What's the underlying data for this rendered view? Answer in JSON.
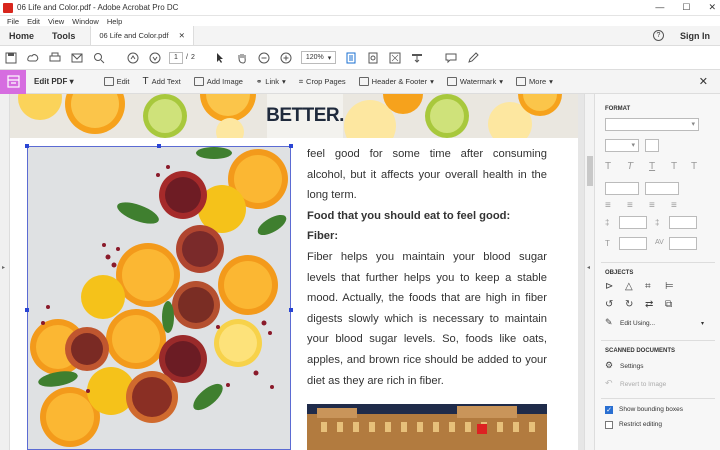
{
  "window": {
    "title": "06 Life and Color.pdf - Adobe Acrobat Pro DC",
    "controls": [
      "—",
      "☐",
      "✕"
    ]
  },
  "menu": [
    "File",
    "Edit",
    "View",
    "Window",
    "Help"
  ],
  "tabs": {
    "home": "Home",
    "tools": "Tools",
    "document": "06 Life and Color.pdf",
    "close": "✕",
    "help": "?",
    "signin": "Sign In"
  },
  "toolbar": {
    "page_current": "1",
    "page_sep": "/",
    "page_total": "2",
    "zoom": "120%"
  },
  "editbar": {
    "title": "Edit PDF",
    "items": [
      "Edit",
      "Add Text",
      "Add Image",
      "Link",
      "Crop Pages",
      "Header & Footer",
      "Watermark",
      "More"
    ],
    "close": "✕"
  },
  "document": {
    "logo": "BETTER.",
    "paragraphs": [
      {
        "style": "normal",
        "text": "feel good for some time after consuming alcohol, but it affects your overall health in the long term."
      },
      {
        "style": "bold",
        "text": "Food that you should eat to feel good:"
      },
      {
        "style": "bold",
        "text": "Fiber:"
      },
      {
        "style": "normal",
        "text": "Fiber helps you maintain your blood sugar levels that further helps you to keep a stable mood. Actually, the foods that are high in fiber digests slowly which is necessary to maintain your blood sugar levels. So, foods like oats, apples, and brown rice should be added to your diet as they are rich in fiber."
      }
    ]
  },
  "rightpanel": {
    "format_heading": "FORMAT",
    "objects_heading": "OBJECTS",
    "edit_using": "Edit Using...",
    "scanned_heading": "SCANNED DOCUMENTS",
    "settings": "Settings",
    "revert": "Revert to Image",
    "show_bounding": "Show bounding boxes",
    "show_bounding_checked": true,
    "restrict_editing": "Restrict editing",
    "restrict_checked": false
  },
  "colors": {
    "accent": "#d66de0",
    "selection": "#2a45d4",
    "acrobat_red": "#d8261d"
  }
}
